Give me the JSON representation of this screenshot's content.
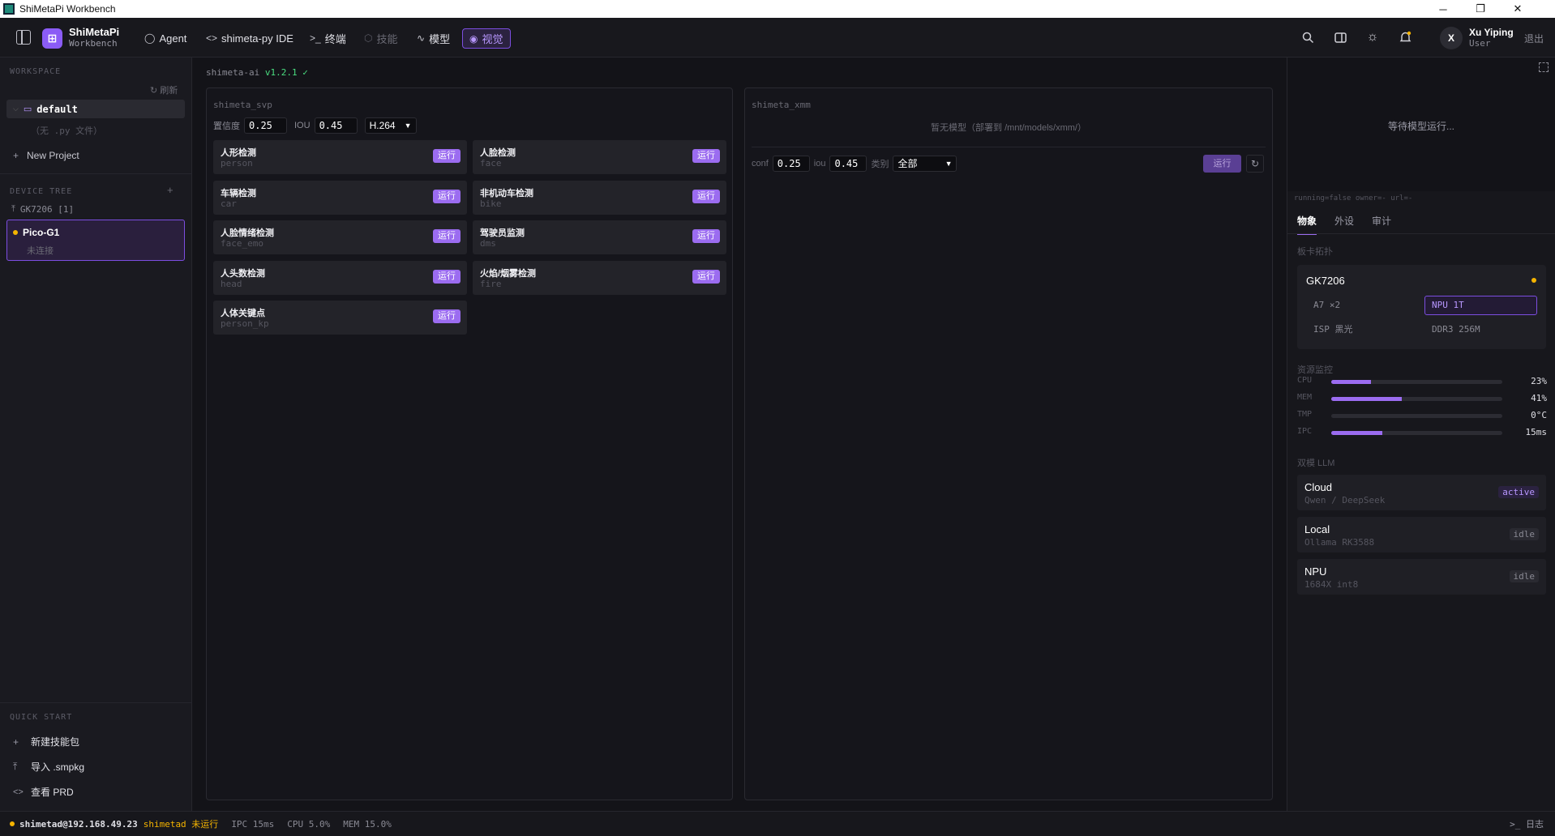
{
  "window": {
    "title": "ShiMetaPi Workbench",
    "min": "─",
    "max": "❐",
    "close": "✕"
  },
  "topbar": {
    "brand_title": "ShiMetaPi",
    "brand_sub": "Workbench",
    "nav": [
      {
        "icon": "chat-icon",
        "glyph": "◯",
        "label": "Agent"
      },
      {
        "icon": "code-icon",
        "glyph": "<>",
        "label": "shimeta-py IDE"
      },
      {
        "icon": "terminal-icon",
        "glyph": ">_",
        "label": "终端"
      },
      {
        "icon": "cube-icon",
        "glyph": "⬡",
        "label": "技能"
      },
      {
        "icon": "pulse-icon",
        "glyph": "∿",
        "label": "模型"
      },
      {
        "icon": "eye-icon",
        "glyph": "◉",
        "label": "视觉"
      }
    ],
    "user_initial": "X",
    "user_name": "Xu Yiping",
    "user_role": "User",
    "logout": "退出"
  },
  "sidebar": {
    "workspace_header": "WORKSPACE",
    "refresh": "刷新",
    "folder": "default",
    "empty_hint": "（无 .py 文件）",
    "new_project": "New Project",
    "device_tree_header": "DEVICE TREE",
    "add": "+",
    "device_group": "GK7206 [1]",
    "device": {
      "name": "Pico-G1",
      "status": "未连接"
    },
    "quick_start_header": "QUICK START",
    "quick": [
      {
        "icon": "plus-icon",
        "glyph": "+",
        "label": "新建技能包"
      },
      {
        "icon": "upload-icon",
        "glyph": "⤒",
        "label": "导入 .smpkg"
      },
      {
        "icon": "code-icon",
        "glyph": "<>",
        "label": "查看 PRD"
      }
    ]
  },
  "main": {
    "version_prefix": "shimeta-ai",
    "version": "v1.2.1 ✓",
    "svp": {
      "title": "shimeta_svp",
      "conf_label": "置信度",
      "conf": "0.25",
      "iou_label": "IOU",
      "iou": "0.45",
      "codec": "H.264",
      "run_label": "运行",
      "cards": [
        {
          "name": "人形检测",
          "key": "person"
        },
        {
          "name": "人脸检测",
          "key": "face"
        },
        {
          "name": "车辆检测",
          "key": "car"
        },
        {
          "name": "非机动车检测",
          "key": "bike"
        },
        {
          "name": "人脸情绪检测",
          "key": "face_emo"
        },
        {
          "name": "驾驶员监测",
          "key": "dms"
        },
        {
          "name": "人头数检测",
          "key": "head"
        },
        {
          "name": "火焰/烟雾检测",
          "key": "fire"
        },
        {
          "name": "人体关键点",
          "key": "person_kp"
        }
      ]
    },
    "xmm": {
      "title": "shimeta_xmm",
      "empty": "暂无模型（部署到 /mnt/models/xmm/）",
      "conf_label": "conf",
      "conf": "0.25",
      "iou_label": "iou",
      "iou": "0.45",
      "class_label": "类别",
      "class": "全部",
      "run": "运行",
      "refresh": "↻"
    }
  },
  "right": {
    "waiting": "等待模型运行...",
    "debug": "running=false owner=- url=-",
    "tabs": [
      "物象",
      "外设",
      "审计"
    ],
    "topo_header": "板卡拓扑",
    "board": "GK7206",
    "chips": [
      "A7 ×2",
      "NPU 1T",
      "ISP 黑光",
      "DDR3 256M"
    ],
    "res_header": "资源监控",
    "resources": [
      {
        "label": "CPU",
        "value": "23%",
        "level": 0.23
      },
      {
        "label": "MEM",
        "value": "41%",
        "level": 0.41
      },
      {
        "label": "TMP",
        "value": "0°C",
        "level": 0
      },
      {
        "label": "IPC",
        "value": "15ms",
        "level": 0.3
      }
    ],
    "llm_header": "双模 LLM",
    "llm": [
      {
        "name": "Cloud",
        "sub": "Qwen / DeepSeek",
        "state": "active"
      },
      {
        "name": "Local",
        "sub": "Ollama RK3588",
        "state": "idle"
      },
      {
        "name": "NPU",
        "sub": "1684X int8",
        "state": "idle"
      }
    ]
  },
  "statusbar": {
    "host": "shimetad@192.168.49.23",
    "service": "shimetad 未运行",
    "ipc": "IPC 15ms",
    "cpu": "CPU 5.0%",
    "mem": "MEM 15.0%",
    "log": ">_ 日志"
  },
  "colors": {
    "accent": "#9b6cf0",
    "warning": "#f5b400",
    "success": "#4ade80"
  }
}
